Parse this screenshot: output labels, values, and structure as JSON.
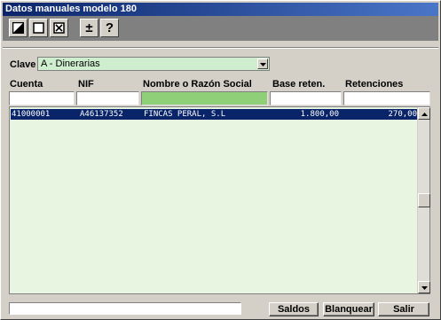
{
  "window": {
    "title": "Datos manuales modelo 180"
  },
  "toolbar": {
    "buttons": [
      {
        "name": "edit",
        "icon": "half-filled-square-icon"
      },
      {
        "name": "new",
        "icon": "empty-square-icon"
      },
      {
        "name": "delete",
        "icon": "x-square-icon"
      },
      {
        "name": "plus-minus",
        "icon": "plus-minus-icon",
        "glyph": "±"
      },
      {
        "name": "help",
        "icon": "question-icon",
        "glyph": "?"
      }
    ]
  },
  "clave": {
    "label": "Clave",
    "value": "A - Dinerarias"
  },
  "columns": [
    "Cuenta",
    "NIF",
    "Nombre o Razón Social",
    "Base reten.",
    "Retenciones"
  ],
  "rows": [
    {
      "cuenta": "41000001",
      "nif": "A46137352",
      "nombre": "FINCAS PERAL, S.L",
      "base": "1.800,00",
      "retenciones": "270,00"
    }
  ],
  "footer": {
    "status_text": "",
    "saldos_label": "Saldos",
    "blanquear_label": "Blanquear",
    "salir_label": "Salir"
  },
  "colors": {
    "title_bar": "#0a246a",
    "grid_background": "#e8f5e1",
    "selected_row": "#0a246a",
    "active_filter": "#8fcf78",
    "combo_background": "#cfeecf"
  }
}
